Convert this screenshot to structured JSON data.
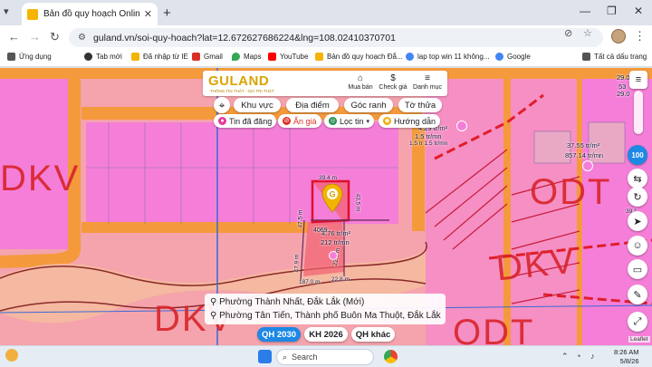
{
  "browser": {
    "tab_title": "Bản đồ quy hoạch Online trực tuyế",
    "url": "guland.vn/soi-quy-hoach?lat=12.672627686224&lng=108.02410370701"
  },
  "bookmarks": [
    {
      "label": "Ứng dụng",
      "color": "#555555"
    },
    {
      "label": "Tab mới",
      "color": "#333333"
    },
    {
      "label": "Đã nhập từ IE",
      "color": "#f2b400"
    },
    {
      "label": "Gmail",
      "color": "#d93025"
    },
    {
      "label": "Maps",
      "color": "#34a853"
    },
    {
      "label": "YouTube",
      "color": "#ff0000"
    },
    {
      "label": "Bản đồ quy hoạch Đắ...",
      "color": "#f6b400"
    },
    {
      "label": "lap top win 11 không...",
      "color": "#4285f4"
    },
    {
      "label": "Google",
      "color": "#4285f4"
    },
    {
      "label": "Tất cả dấu trang",
      "color": "#555555"
    }
  ],
  "guland": {
    "logo": "GULAND",
    "slogan": "THÔNG TIN THẬT · GIÁ TRỊ THẬT",
    "actions": [
      {
        "label": "Mua bán",
        "glyph": "⌂"
      },
      {
        "label": "Check giá",
        "glyph": "$"
      },
      {
        "label": "Danh mục",
        "glyph": "≡"
      }
    ],
    "search_tabs": [
      "Khu vực",
      "Địa điểm",
      "Góc ranh",
      "Tờ thửa"
    ],
    "filters": [
      {
        "label": "Tin đã đăng",
        "color": "#e5399b"
      },
      {
        "label": "Ẩn giá",
        "color": "#d93025"
      },
      {
        "label": "Lọc tin",
        "color": "#1a8a4a"
      },
      {
        "label": "Hướng dẫn",
        "color": "#f2a900"
      }
    ],
    "plan_tabs": [
      "QH 2030",
      "KH 2026",
      "QH khác"
    ],
    "zoom_badge": "100"
  },
  "map_labels": {
    "price_1": "4.29 tr/m²",
    "price_1b": "1.5 tr/mn",
    "price_1c": "1.5 tr 1.5 tr/mn",
    "price_2": "37.55 tr/m²",
    "price_2b": "857.14 tr/mn",
    "price_3": "29.0",
    "price_3b": "53",
    "price_3c": "29.0",
    "price_4": "4.76 tr/m²",
    "price_4b": "212 tr/mn",
    "area_4069": "4069",
    "dim_top": "39.4 m",
    "dim_right": "43.5 m",
    "dim_left": "47.5 m",
    "dim_left2": "47.9 m",
    "dim_bottom": "187.0 m",
    "dim_bottom2": "22.8 m",
    "dim_mid": "22.5 m",
    "dim_far": "39.1",
    "zone_dkv_left": "DKV",
    "zone_odt_right": "ODT",
    "zone_dkv_right": "DKV",
    "zone_dkv_bottom": "DKV",
    "zone_odt_bottom": "ODT"
  },
  "address": {
    "line1": "Phường Thành Nhất, Đắk Lắk (Mới)",
    "line2": "Phường Tân Tiến, Thành phố Buôn Ma Thuột, Đắk Lắk"
  },
  "attribution": "Leaflet",
  "taskbar": {
    "search_placeholder": "Search",
    "time": "8:26 AM",
    "date": "5/8/26"
  }
}
